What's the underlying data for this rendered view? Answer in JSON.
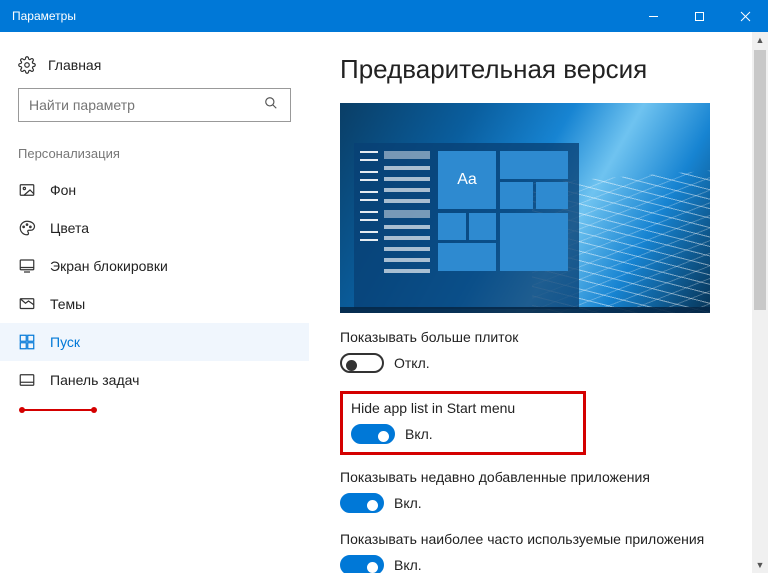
{
  "window": {
    "title": "Параметры"
  },
  "sidebar": {
    "home": "Главная",
    "search_placeholder": "Найти параметр",
    "group": "Персонализация",
    "items": [
      {
        "label": "Фон"
      },
      {
        "label": "Цвета"
      },
      {
        "label": "Экран блокировки"
      },
      {
        "label": "Темы"
      },
      {
        "label": "Пуск"
      },
      {
        "label": "Панель задач"
      }
    ]
  },
  "main": {
    "heading": "Предварительная версия",
    "preview_tile_text": "Aa",
    "settings": [
      {
        "title": "Показывать больше плиток",
        "state": "off",
        "state_label": "Откл."
      },
      {
        "title": "Hide app list in Start menu",
        "state": "on",
        "state_label": "Вкл."
      },
      {
        "title": "Показывать недавно добавленные приложения",
        "state": "on",
        "state_label": "Вкл."
      },
      {
        "title": "Показывать наиболее часто используемые приложения",
        "state": "on",
        "state_label": "Вкл."
      }
    ]
  }
}
